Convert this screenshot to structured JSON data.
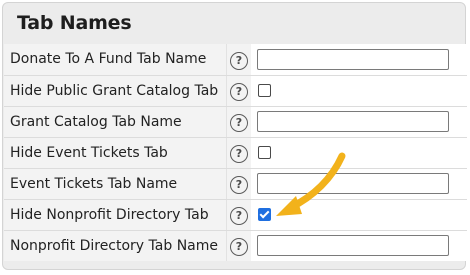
{
  "panel": {
    "title": "Tab Names"
  },
  "rows": [
    {
      "label": "Donate To A Fund Tab Name",
      "type": "text",
      "value": ""
    },
    {
      "label": "Hide Public Grant Catalog Tab",
      "type": "checkbox",
      "checked": false
    },
    {
      "label": "Grant Catalog Tab Name",
      "type": "text",
      "value": ""
    },
    {
      "label": "Hide Event Tickets Tab",
      "type": "checkbox",
      "checked": false
    },
    {
      "label": "Event Tickets Tab Name",
      "type": "text",
      "value": ""
    },
    {
      "label": "Hide Nonprofit Directory Tab",
      "type": "checkbox",
      "checked": true
    },
    {
      "label": "Nonprofit Directory Tab Name",
      "type": "text",
      "value": ""
    }
  ],
  "help_icon_glyph": "?",
  "icons": {
    "help": "help-icon",
    "annotation_arrow": "arrow-icon"
  },
  "colors": {
    "panel_background": "#ececec",
    "checkbox_checked": "#1f6fe0",
    "annotation_arrow": "#f2b21b"
  }
}
